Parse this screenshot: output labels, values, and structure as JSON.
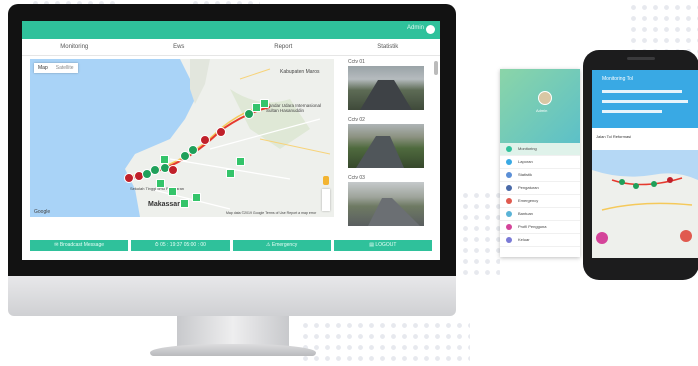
{
  "header": {
    "user_label": "Admin"
  },
  "tabs": [
    {
      "label": "Monitoring"
    },
    {
      "label": "Ews"
    },
    {
      "label": "Report"
    },
    {
      "label": "Statistik"
    }
  ],
  "map": {
    "toggle": {
      "map_label": "Map",
      "satellite_label": "Satellite"
    },
    "labels": {
      "city": "Makassar",
      "airport": "Bandar Udara Internasional Sultan Hasanuddin",
      "area": "Kabupaten Maros",
      "port": "Sekolah Tinggi Ilmu Pelayaran",
      "google": "Google",
      "attribution": "Map data ©2019 Google   Terms of Use   Report a map error"
    },
    "route_color": "#e53a2e"
  },
  "cameras": [
    {
      "label": "Cctv 01"
    },
    {
      "label": "Cctv 02"
    },
    {
      "label": "Cctv 03"
    }
  ],
  "buttons": [
    {
      "label": "✉ Broadcast Message"
    },
    {
      "label": "⏱ 05 : 19:37  05:00 : 00"
    },
    {
      "label": "⚠ Emergency"
    },
    {
      "label": "▤ LOGOUT"
    }
  ],
  "tablet": {
    "name": "Admin",
    "items": [
      {
        "label": "Monitoring",
        "color": "#2fc19b"
      },
      {
        "label": "Laporan",
        "color": "#39a9e4"
      },
      {
        "label": "Statistik",
        "color": "#5b8fd6"
      },
      {
        "label": "Pengaturan",
        "color": "#4a6aa8"
      },
      {
        "label": "Emergency",
        "color": "#e05a4f"
      },
      {
        "label": "Bantuan",
        "color": "#5ab3d6"
      },
      {
        "label": "Profil Pengguna",
        "color": "#d4449a"
      },
      {
        "label": "Keluar",
        "color": "#7a7ad6"
      }
    ]
  },
  "phone": {
    "title": "Monitoring Tol",
    "info": "Jalan Tol Reformasi"
  }
}
